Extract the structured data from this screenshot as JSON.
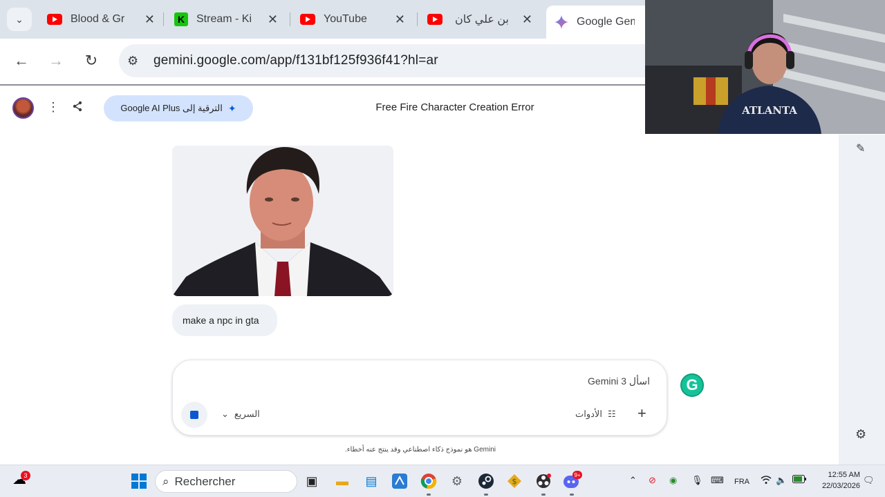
{
  "browser": {
    "tabs": [
      {
        "title": "Blood & Gr",
        "icon": "youtube-icon",
        "close": "✕"
      },
      {
        "title": "Stream - Ki",
        "icon": "kick-icon",
        "close": "✕"
      },
      {
        "title": "YouTube",
        "icon": "youtube-icon",
        "close": "✕"
      },
      {
        "title": "بن علي كان",
        "icon": "youtube-icon",
        "close": "✕"
      },
      {
        "title": "Google Gem",
        "icon": "gemini-icon",
        "active": true
      }
    ],
    "url": "gemini.google.com/app/f131bf125f936f41?hl=ar"
  },
  "gemini": {
    "upgrade_label": "الترقية إلى Google AI Plus",
    "conversation_title": "Free Fire Character Creation Error",
    "user_message": "make a npc in gta",
    "input_placeholder": "اسأل Gemini 3",
    "model_label": "السريع",
    "tools_label": "الأدوات",
    "disclaimer": "Gemini هو نموذج ذكاء اصطناعي وقد ينتج عنه أخطاء."
  },
  "taskbar": {
    "search_placeholder": "Rechercher",
    "weather_badge": "3",
    "chrome_badge": "",
    "discord_badge": "9+",
    "language": "FRA",
    "time": "12:55 AM",
    "date": "22/03/2026"
  },
  "colors": {
    "accent": "#0b57d0",
    "upgrade_bg": "#d3e3fd",
    "tabstrip_bg": "#dde3ea",
    "youtube_red": "#ff0000",
    "kick_green": "#16c60c"
  }
}
